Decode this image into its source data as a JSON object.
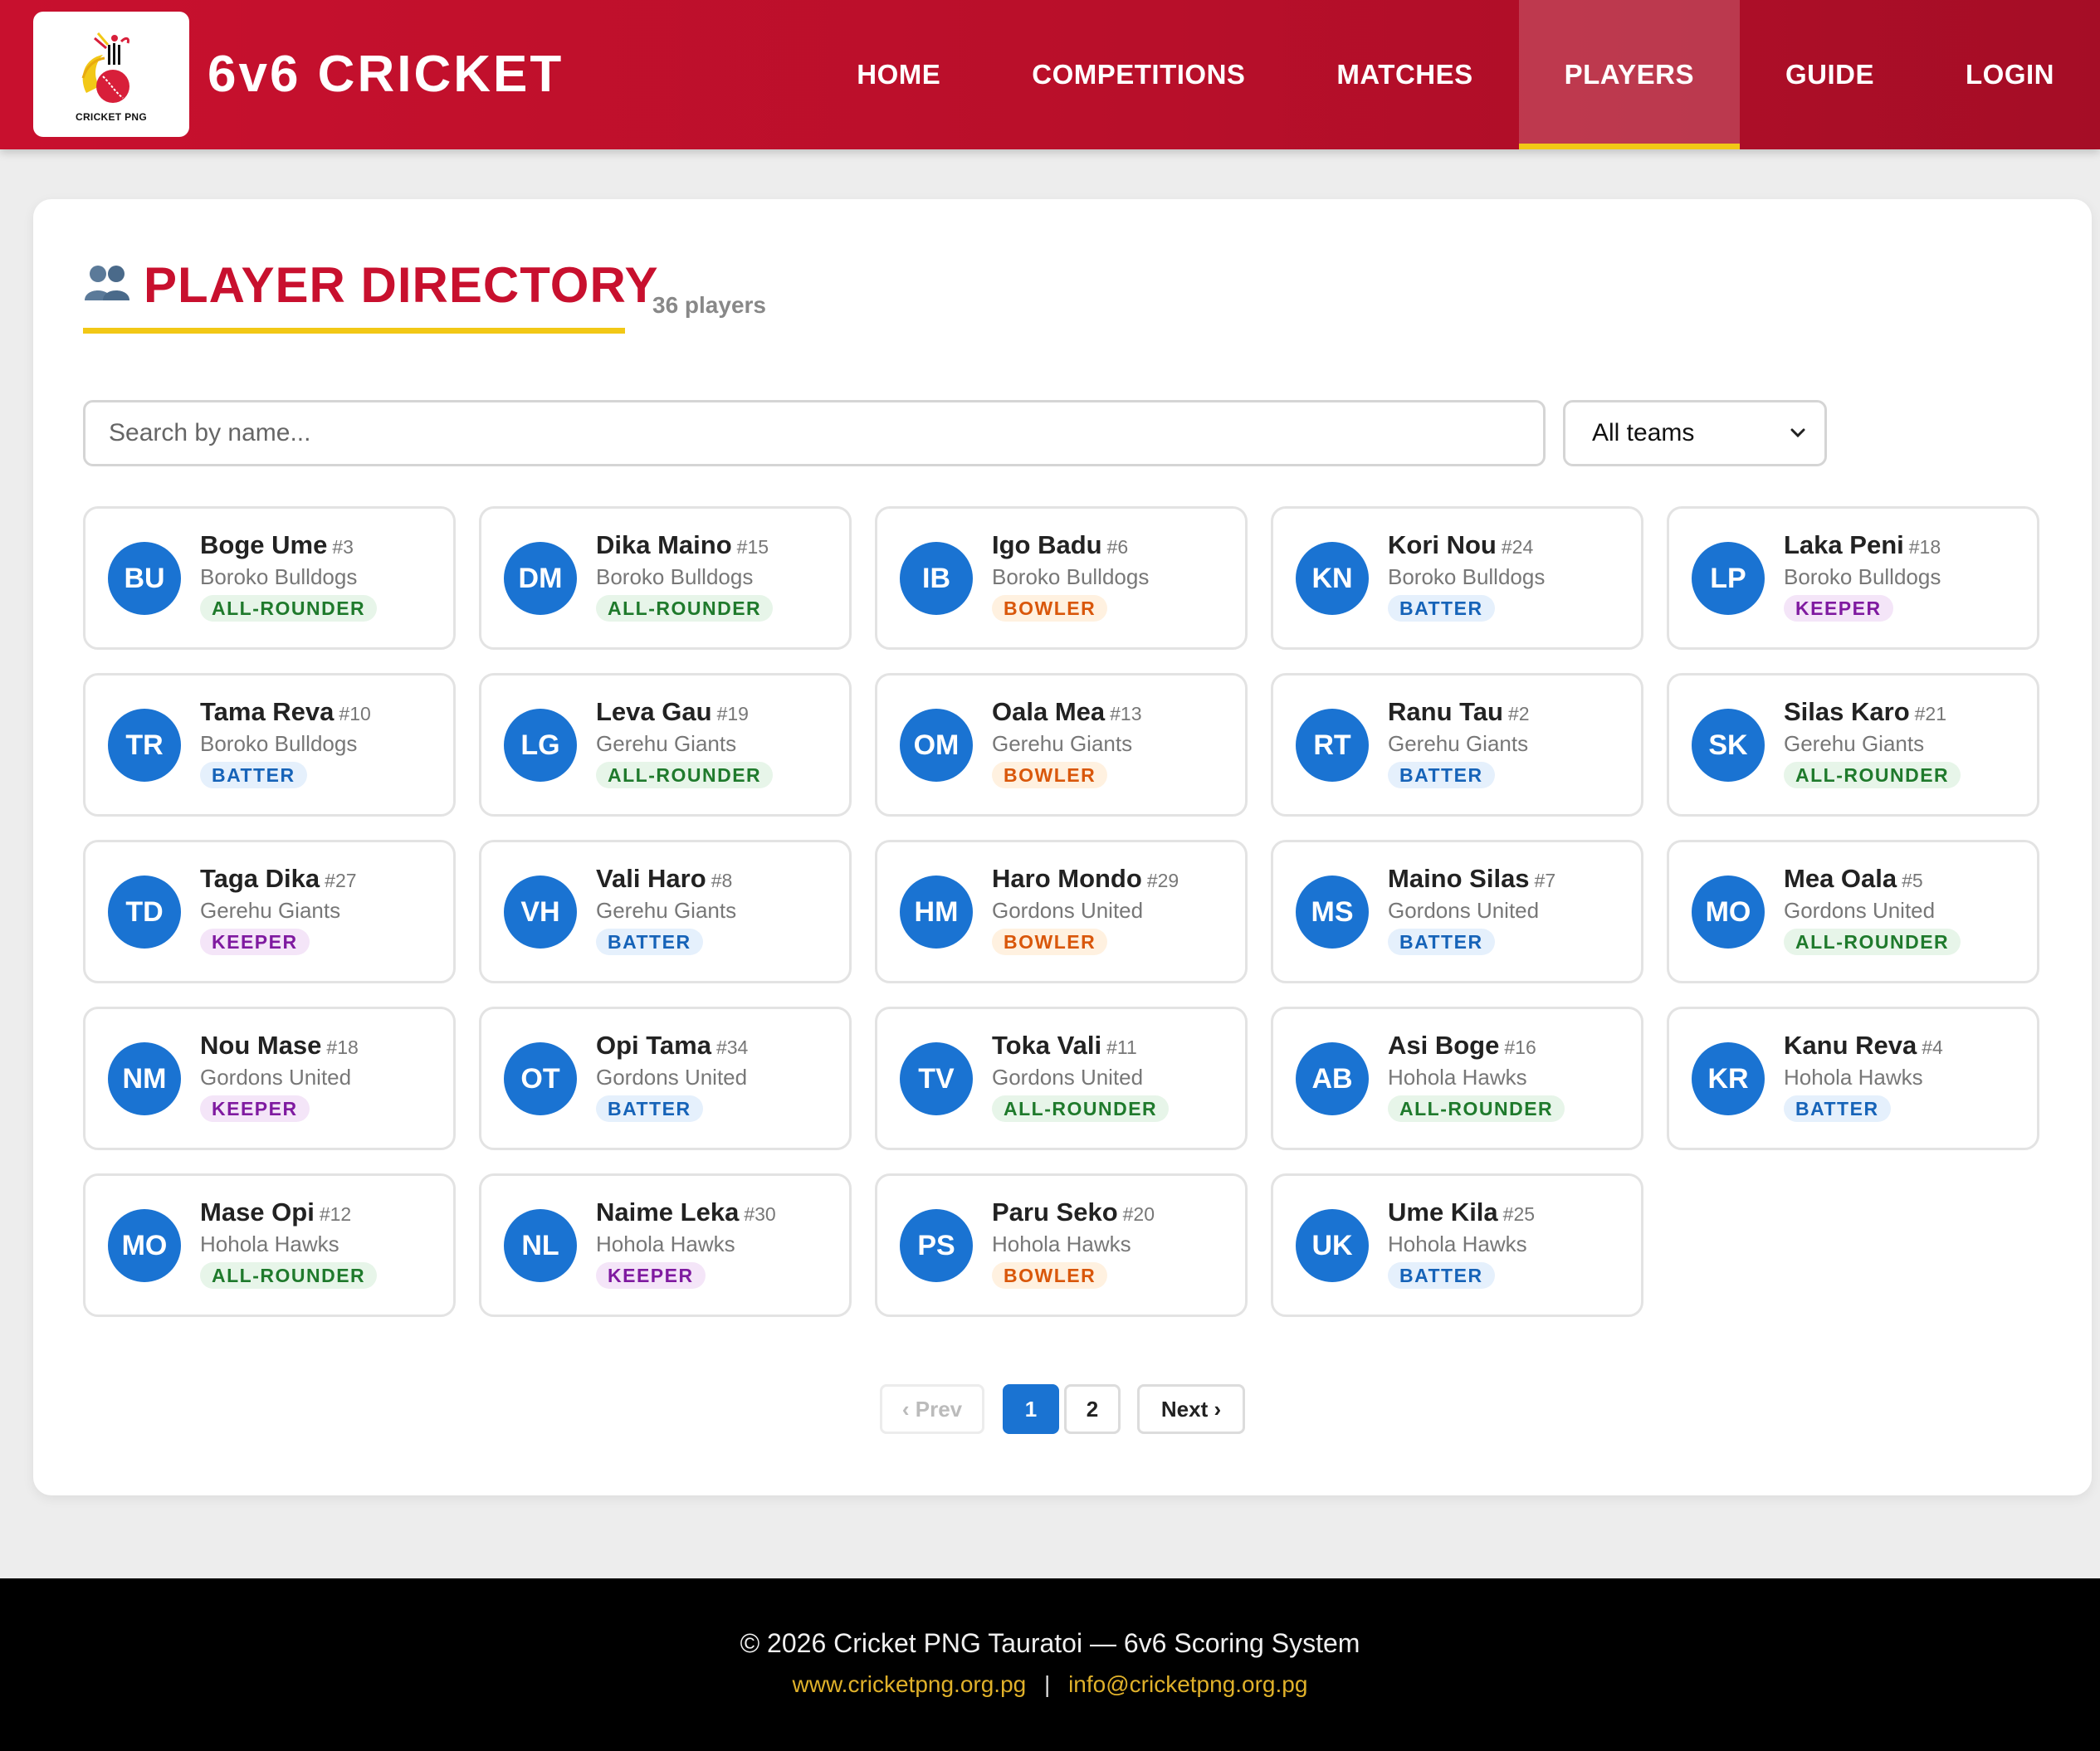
{
  "header": {
    "logo_text": "CRICKET PNG",
    "brand": "6v6 CRICKET",
    "nav": [
      {
        "label": "HOME",
        "active": false
      },
      {
        "label": "COMPETITIONS",
        "active": false
      },
      {
        "label": "MATCHES",
        "active": false
      },
      {
        "label": "PLAYERS",
        "active": true
      },
      {
        "label": "GUIDE",
        "active": false
      },
      {
        "label": "LOGIN",
        "active": false
      }
    ]
  },
  "main": {
    "title": "PLAYER DIRECTORY",
    "title_icon": "people-icon",
    "count": "36 players",
    "search": {
      "placeholder": "Search by name...",
      "value": ""
    },
    "team_filter": {
      "selected": "All teams"
    },
    "players": [
      {
        "initials": "BU",
        "name": "Boge Ume",
        "number": "#3",
        "team": "Boroko Bulldogs",
        "role": "ALL-ROUNDER"
      },
      {
        "initials": "DM",
        "name": "Dika Maino",
        "number": "#15",
        "team": "Boroko Bulldogs",
        "role": "ALL-ROUNDER"
      },
      {
        "initials": "IB",
        "name": "Igo Badu",
        "number": "#6",
        "team": "Boroko Bulldogs",
        "role": "BOWLER"
      },
      {
        "initials": "KN",
        "name": "Kori Nou",
        "number": "#24",
        "team": "Boroko Bulldogs",
        "role": "BATTER"
      },
      {
        "initials": "LP",
        "name": "Laka Peni",
        "number": "#18",
        "team": "Boroko Bulldogs",
        "role": "KEEPER"
      },
      {
        "initials": "TR",
        "name": "Tama Reva",
        "number": "#10",
        "team": "Boroko Bulldogs",
        "role": "BATTER"
      },
      {
        "initials": "LG",
        "name": "Leva Gau",
        "number": "#19",
        "team": "Gerehu Giants",
        "role": "ALL-ROUNDER"
      },
      {
        "initials": "OM",
        "name": "Oala Mea",
        "number": "#13",
        "team": "Gerehu Giants",
        "role": "BOWLER"
      },
      {
        "initials": "RT",
        "name": "Ranu Tau",
        "number": "#2",
        "team": "Gerehu Giants",
        "role": "BATTER"
      },
      {
        "initials": "SK",
        "name": "Silas Karo",
        "number": "#21",
        "team": "Gerehu Giants",
        "role": "ALL-ROUNDER"
      },
      {
        "initials": "TD",
        "name": "Taga Dika",
        "number": "#27",
        "team": "Gerehu Giants",
        "role": "KEEPER"
      },
      {
        "initials": "VH",
        "name": "Vali Haro",
        "number": "#8",
        "team": "Gerehu Giants",
        "role": "BATTER"
      },
      {
        "initials": "HM",
        "name": "Haro Mondo",
        "number": "#29",
        "team": "Gordons United",
        "role": "BOWLER"
      },
      {
        "initials": "MS",
        "name": "Maino Silas",
        "number": "#7",
        "team": "Gordons United",
        "role": "BATTER"
      },
      {
        "initials": "MO",
        "name": "Mea Oala",
        "number": "#5",
        "team": "Gordons United",
        "role": "ALL-ROUNDER"
      },
      {
        "initials": "NM",
        "name": "Nou Mase",
        "number": "#18",
        "team": "Gordons United",
        "role": "KEEPER"
      },
      {
        "initials": "OT",
        "name": "Opi Tama",
        "number": "#34",
        "team": "Gordons United",
        "role": "BATTER"
      },
      {
        "initials": "TV",
        "name": "Toka Vali",
        "number": "#11",
        "team": "Gordons United",
        "role": "ALL-ROUNDER"
      },
      {
        "initials": "AB",
        "name": "Asi Boge",
        "number": "#16",
        "team": "Hohola Hawks",
        "role": "ALL-ROUNDER"
      },
      {
        "initials": "KR",
        "name": "Kanu Reva",
        "number": "#4",
        "team": "Hohola Hawks",
        "role": "BATTER"
      },
      {
        "initials": "MO",
        "name": "Mase Opi",
        "number": "#12",
        "team": "Hohola Hawks",
        "role": "ALL-ROUNDER"
      },
      {
        "initials": "NL",
        "name": "Naime Leka",
        "number": "#30",
        "team": "Hohola Hawks",
        "role": "KEEPER"
      },
      {
        "initials": "PS",
        "name": "Paru Seko",
        "number": "#20",
        "team": "Hohola Hawks",
        "role": "BOWLER"
      },
      {
        "initials": "UK",
        "name": "Ume Kila",
        "number": "#25",
        "team": "Hohola Hawks",
        "role": "BATTER"
      }
    ],
    "pagination": {
      "prev": "‹ Prev",
      "pages": [
        "1",
        "2"
      ],
      "current": "1",
      "next": "Next ›"
    }
  },
  "footer": {
    "copyright": "© 2026 Cricket PNG Tauratoi — 6v6 Scoring System",
    "website": "www.cricketpng.org.pg",
    "separator": "|",
    "email": "info@cricketpng.org.pg"
  },
  "colors": {
    "header_red": "#c8102e",
    "accent_yellow": "#f2c816",
    "avatar_blue": "#1a73d2",
    "allrounder_green": "#1f7a2c",
    "bowler_orange": "#d9570b",
    "batter_blue": "#1663b8",
    "keeper_purple": "#7f1aa0"
  }
}
